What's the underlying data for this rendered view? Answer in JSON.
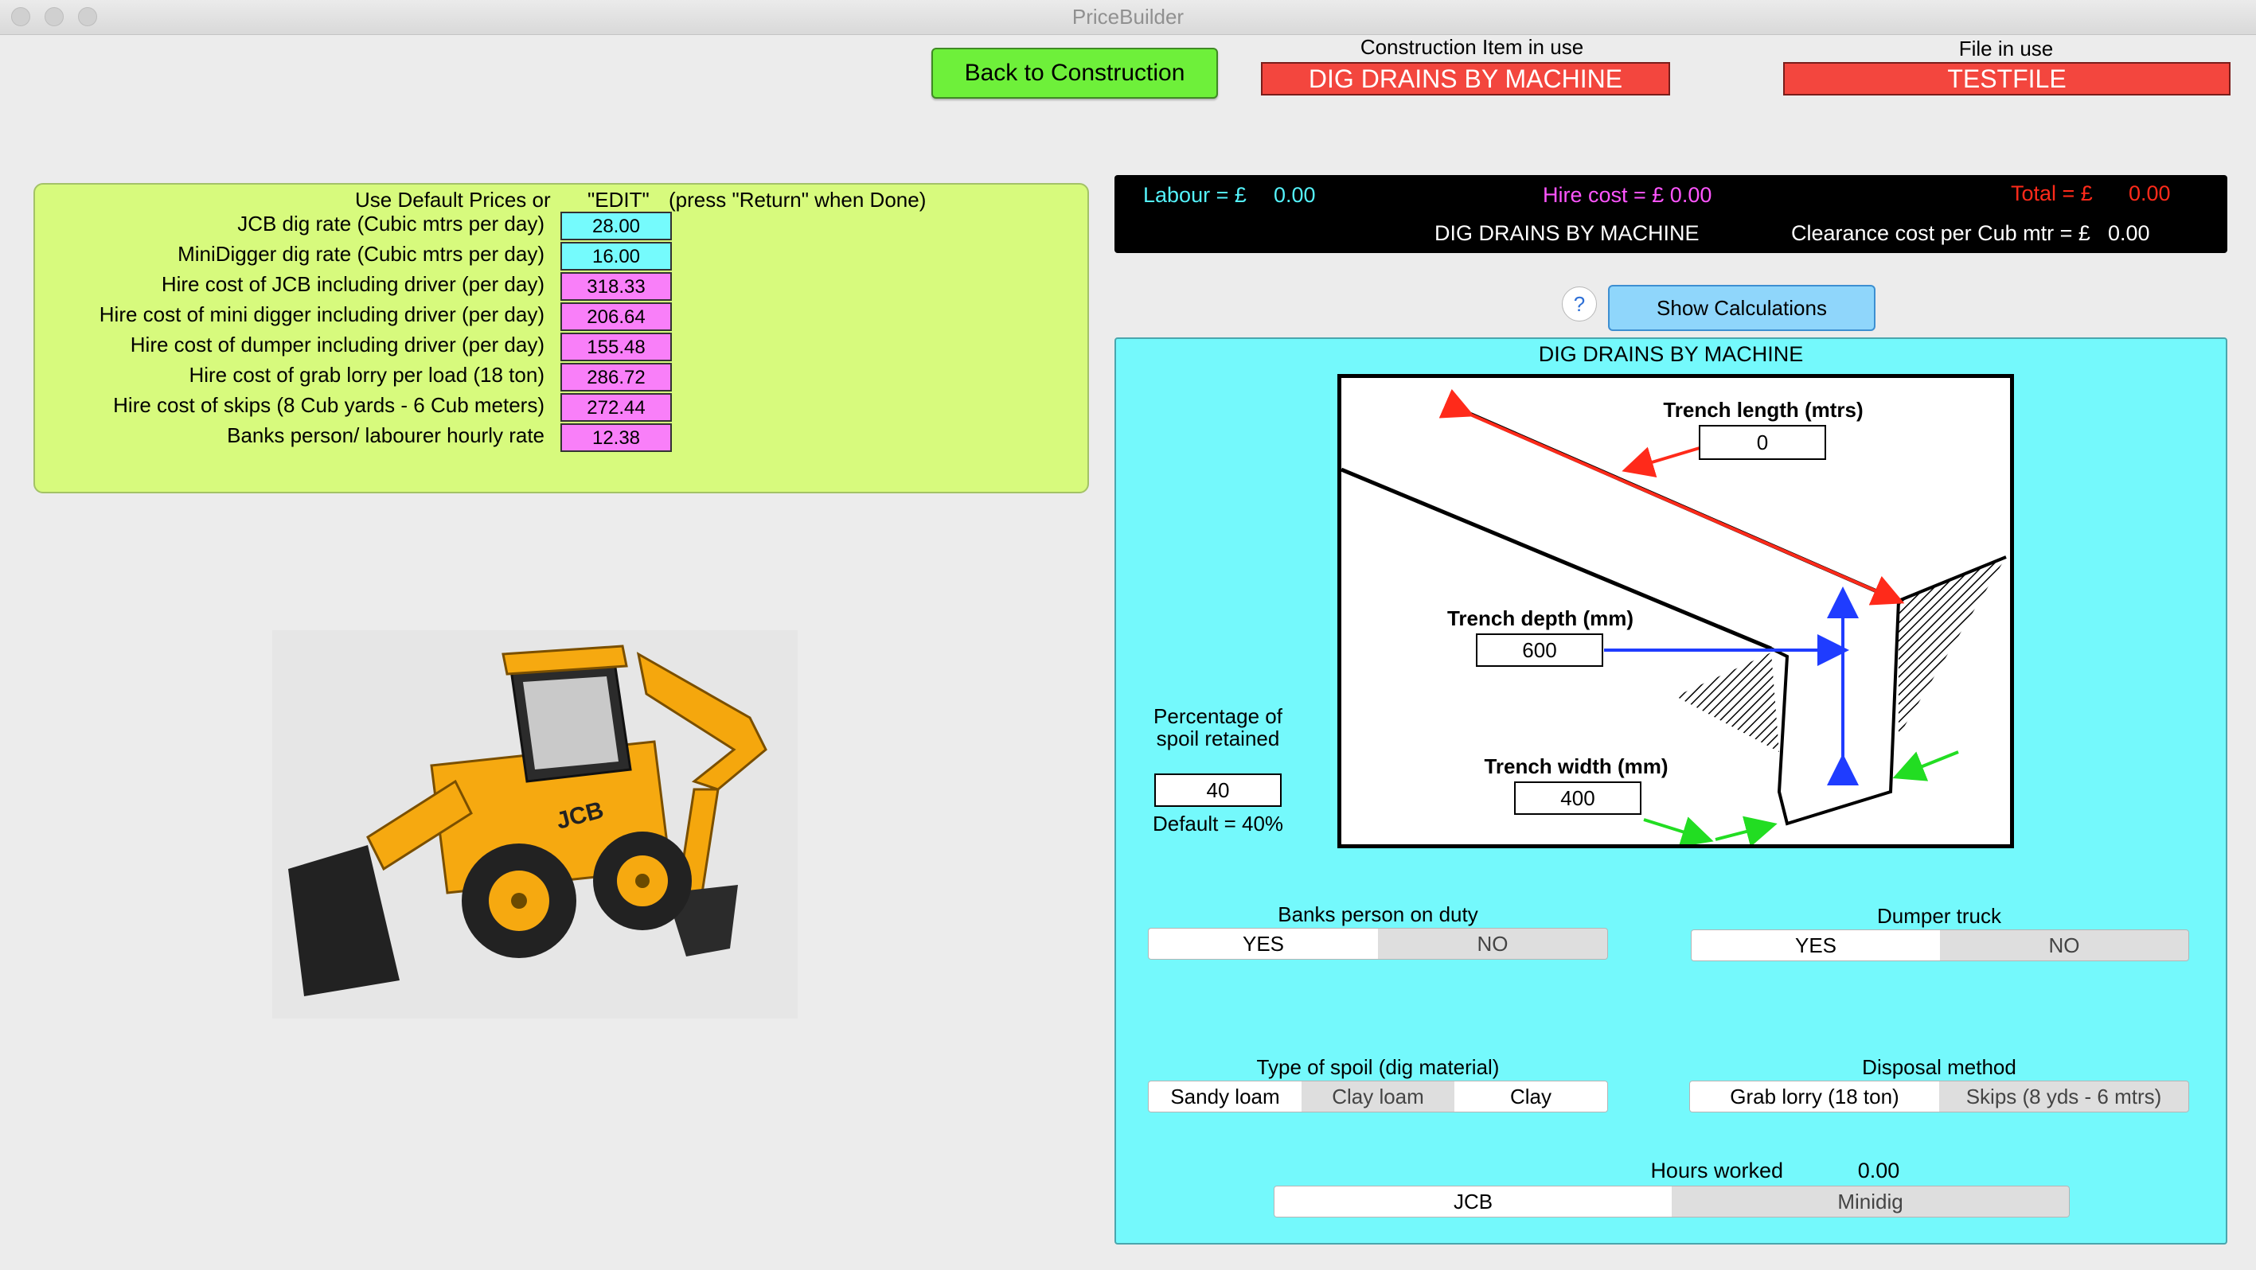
{
  "window": {
    "title": "PriceBuilder"
  },
  "header": {
    "back_button": "Back to Construction",
    "construction_label": "Construction Item in use",
    "construction_value": "DIG DRAINS BY MACHINE",
    "file_label": "File in use",
    "file_value": "TESTFILE"
  },
  "prices": {
    "heading_a": "Use Default Prices or",
    "heading_b": "\"EDIT\"",
    "heading_c": "(press \"Return\" when Done)",
    "rows": [
      {
        "label": "JCB dig rate (Cubic mtrs per day)",
        "value": "28.00"
      },
      {
        "label": "MiniDigger dig rate (Cubic mtrs per day)",
        "value": "16.00"
      },
      {
        "label": "Hire cost of JCB including driver (per day)",
        "value": "318.33"
      },
      {
        "label": "Hire cost of mini digger including driver (per day)",
        "value": "206.64"
      },
      {
        "label": "Hire cost of dumper including driver (per day)",
        "value": "155.48"
      },
      {
        "label": "Hire cost of grab lorry per load (18 ton)",
        "value": "286.72"
      },
      {
        "label": "Hire cost of skips (8 Cub yards - 6 Cub meters)",
        "value": "272.44"
      },
      {
        "label": "Banks person/ labourer hourly rate",
        "value": "12.38"
      }
    ]
  },
  "summary": {
    "labour_label": "Labour = £",
    "labour_value": "0.00",
    "hire_label": "Hire cost = £ 0.00",
    "total_label": "Total = £",
    "total_value": "0.00",
    "item_name": "DIG DRAINS BY MACHINE",
    "clearance_label": "Clearance cost per Cub mtr = £",
    "clearance_value": "0.00"
  },
  "help_glyph": "?",
  "show_calculations": "Show Calculations",
  "calc": {
    "title": "DIG DRAINS BY MACHINE",
    "trench_length_label": "Trench length (mtrs)",
    "trench_length_value": "0",
    "trench_depth_label": "Trench depth (mm)",
    "trench_depth_value": "600",
    "trench_width_label": "Trench width (mm)",
    "trench_width_value": "400",
    "spoil_label": "Percentage of spoil retained",
    "spoil_value": "40",
    "spoil_default": "Default = 40%",
    "banks_label": "Banks person on duty",
    "banks_options": [
      "YES",
      "NO"
    ],
    "dumper_label": "Dumper truck",
    "dumper_options": [
      "YES",
      "NO"
    ],
    "spoil_type_label": "Type of spoil (dig material)",
    "spoil_type_options": [
      "Sandy loam",
      "Clay loam",
      "Clay"
    ],
    "disposal_label": "Disposal method",
    "disposal_options": [
      "Grab lorry (18 ton)",
      "Skips (8 yds - 6 mtrs)"
    ],
    "hours_label": "Hours worked",
    "hours_value": "0.00",
    "machine_options": [
      "JCB",
      "Minidig"
    ]
  },
  "colors": {
    "labour": "#54f2fb",
    "hire": "#ff55ff",
    "total": "#ff2a1a",
    "red_box": "#f3463e",
    "green_button": "#6ef03a",
    "cyan_panel": "#74f9fc",
    "lime_panel": "#d7fa7d"
  },
  "icons": [
    "close-icon",
    "minimize-icon",
    "zoom-icon",
    "help-icon"
  ]
}
